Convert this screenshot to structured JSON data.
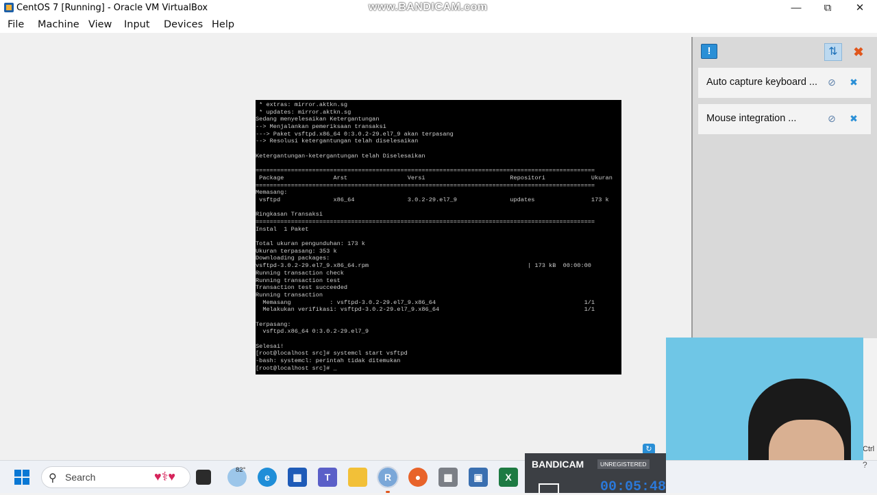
{
  "window": {
    "title": "CentOS 7 [Running] - Oracle VM VirtualBox",
    "minimize": "—",
    "maximize": "⧉",
    "close": "✕"
  },
  "watermark": "www.BANDICAM.com",
  "menu": [
    "File",
    "Machine",
    "View",
    "Input",
    "Devices",
    "Help"
  ],
  "console": {
    "lines": [
      " * extras: mirror.aktkn.sg",
      " * updates: mirror.aktkn.sg",
      "Sedang menyelesaikan Ketergantungan",
      "--> Menjalankan pemeriksaan transaksi",
      "---> Paket vsftpd.x86_64 0:3.0.2-29.el7_9 akan terpasang",
      "--> Resolusi ketergantungan telah diselesaikan",
      "",
      "Ketergantungan-ketergantungan telah Diselesaikan",
      "",
      "================================================================================================",
      " Package              Arst                 Versi                        Repositori             Ukuran",
      "================================================================================================",
      "Memasang:",
      " vsftpd               x86_64               3.0.2-29.el7_9               updates                173 k",
      "",
      "Ringkasan Transaksi",
      "================================================================================================",
      "Instal  1 Paket",
      "",
      "Total ukuran pengunduhan: 173 k",
      "Ukuran terpasang: 353 k",
      "Downloading packages:",
      "vsftpd-3.0.2-29.el7_9.x86_64.rpm                                             | 173 kB  00:00:00",
      "Running transaction check",
      "Running transaction test",
      "Transaction test succeeded",
      "Running transaction",
      "  Memasang           : vsftpd-3.0.2-29.el7_9.x86_64                                          1/1",
      "  Melakukan verifikasi: vsftpd-3.0.2-29.el7_9.x86_64                                         1/1",
      "",
      "Terpasang:",
      "  vsftpd.x86_64 0:3.0.2-29.el7_9",
      "",
      "Selesai!",
      "[root@localhost src]# systemcl start vsftpd",
      "-bash: systemcl: perintah tidak ditemukan",
      "[root@localhost src]# _"
    ]
  },
  "notifications": {
    "items": [
      {
        "label": "Auto capture keyboard ..."
      },
      {
        "label": "Mouse integration ..."
      }
    ]
  },
  "taskbar": {
    "search_label": "Search",
    "weather_temp": "82°"
  },
  "bandicam": {
    "logo": "BANDICAM",
    "status": "UNREGISTERED",
    "timer": "00:05:48"
  },
  "host_key": "Ctrl",
  "help_glyph": "?"
}
